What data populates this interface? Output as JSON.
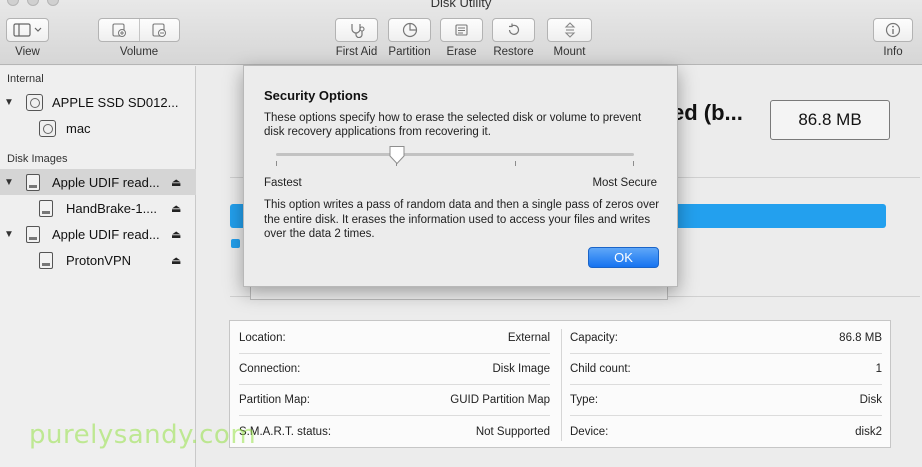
{
  "window": {
    "title": "Disk Utility"
  },
  "toolbar": {
    "view_label": "View",
    "volume_label": "Volume",
    "first_aid_label": "First Aid",
    "partition_label": "Partition",
    "erase_label": "Erase",
    "restore_label": "Restore",
    "mount_label": "Mount",
    "info_label": "Info"
  },
  "sidebar": {
    "internal_header": "Internal",
    "disk_images_header": "Disk Images",
    "items": [
      {
        "label": "APPLE SSD SD012..."
      },
      {
        "label": "mac"
      },
      {
        "label": "Apple UDIF read..."
      },
      {
        "label": "HandBrake-1...."
      },
      {
        "label": "Apple UDIF read..."
      },
      {
        "label": "ProtonVPN"
      }
    ],
    "eject_icon": "eject-icon"
  },
  "main": {
    "volume_name": "ed (b...",
    "size": "86.8 MB",
    "usage_color": "#23a0ee"
  },
  "info": {
    "left": [
      {
        "label": "Location:",
        "value": "External"
      },
      {
        "label": "Connection:",
        "value": "Disk Image"
      },
      {
        "label": "Partition Map:",
        "value": "GUID Partition Map"
      },
      {
        "label": "S.M.A.R.T. status:",
        "value": "Not Supported"
      }
    ],
    "right": [
      {
        "label": "Capacity:",
        "value": "86.8 MB"
      },
      {
        "label": "Child count:",
        "value": "1"
      },
      {
        "label": "Type:",
        "value": "Disk"
      },
      {
        "label": "Device:",
        "value": "disk2"
      }
    ]
  },
  "modal": {
    "title": "Security Options",
    "description": "These options specify how to erase the selected disk or volume to prevent disk recovery applications from recovering it.",
    "slider_left_label": "Fastest",
    "slider_right_label": "Most Secure",
    "slider_position": "2 of 4",
    "detail": "This option writes a pass of random data and then a single pass of zeros over the entire disk. It erases the information used to access your files and writes over the data 2 times.",
    "ok_label": "OK",
    "ok_color": "#1673f0"
  },
  "watermark": {
    "text": "purelysandy.com"
  }
}
